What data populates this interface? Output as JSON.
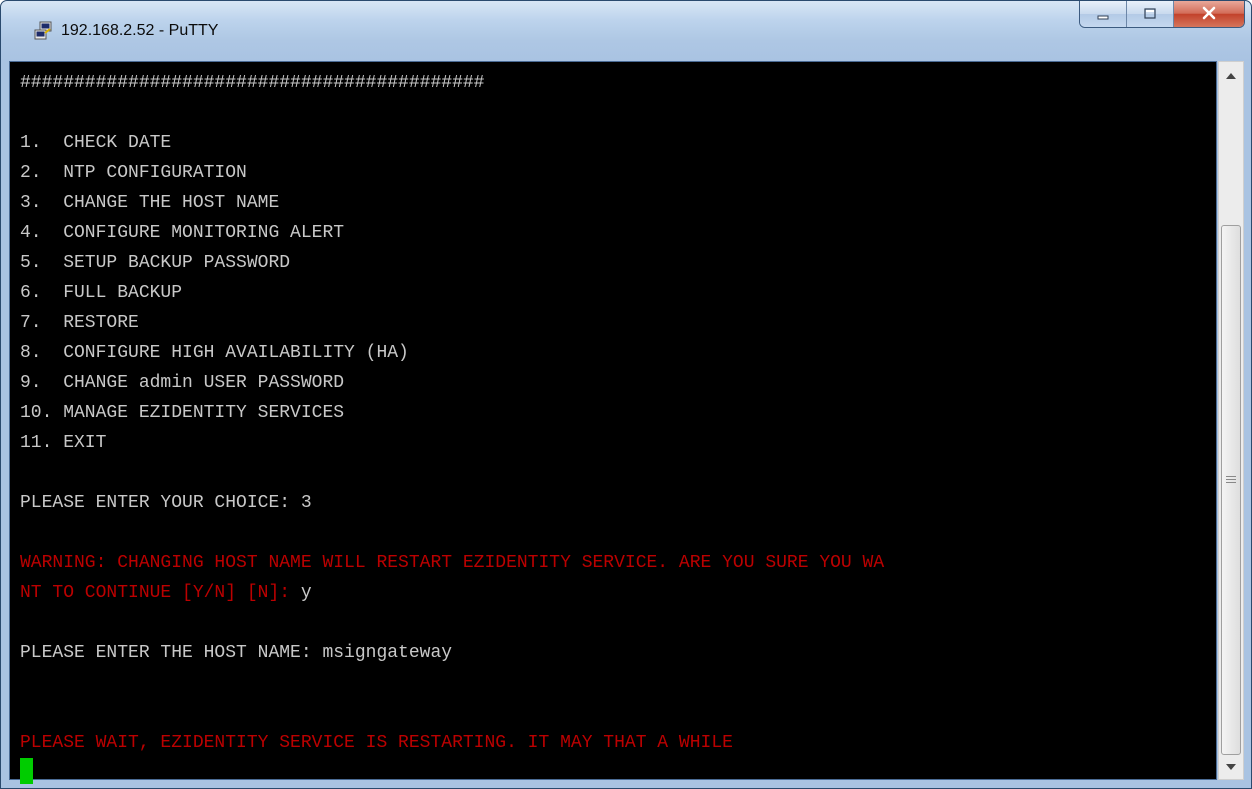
{
  "window": {
    "title": "192.168.2.52 - PuTTY",
    "icons": [
      "putty-app-icon",
      "minimize-icon",
      "maximize-icon",
      "close-icon"
    ]
  },
  "terminal": {
    "lines": [
      {
        "text": "###########################################",
        "color": "#c8c8c8"
      },
      {
        "text": "",
        "color": "#c8c8c8"
      },
      {
        "text": "1.  CHECK DATE",
        "color": "#c8c8c8"
      },
      {
        "text": "2.  NTP CONFIGURATION",
        "color": "#c8c8c8"
      },
      {
        "text": "3.  CHANGE THE HOST NAME",
        "color": "#c8c8c8"
      },
      {
        "text": "4.  CONFIGURE MONITORING ALERT",
        "color": "#c8c8c8"
      },
      {
        "text": "5.  SETUP BACKUP PASSWORD",
        "color": "#c8c8c8"
      },
      {
        "text": "6.  FULL BACKUP",
        "color": "#c8c8c8"
      },
      {
        "text": "7.  RESTORE",
        "color": "#c8c8c8"
      },
      {
        "text": "8.  CONFIGURE HIGH AVAILABILITY (HA)",
        "color": "#c8c8c8"
      },
      {
        "text": "9.  CHANGE admin USER PASSWORD",
        "color": "#c8c8c8"
      },
      {
        "text": "10. MANAGE EZIDENTITY SERVICES",
        "color": "#c8c8c8"
      },
      {
        "text": "11. EXIT",
        "color": "#c8c8c8"
      },
      {
        "text": "",
        "color": "#c8c8c8"
      },
      {
        "text": "PLEASE ENTER YOUR CHOICE: 3",
        "color": "#c8c8c8"
      },
      {
        "text": "",
        "color": "#c8c8c8"
      },
      {
        "text": "WARNING: CHANGING HOST NAME WILL RESTART EZIDENTITY SERVICE. ARE YOU SURE YOU WA",
        "color": "#bb0000"
      },
      {
        "text": "NT TO CONTINUE [Y/N] [N]: ",
        "color": "#bb0000",
        "input": "y"
      },
      {
        "text": "",
        "color": "#c8c8c8"
      },
      {
        "text": "PLEASE ENTER THE HOST NAME: msigngateway",
        "color": "#c8c8c8"
      },
      {
        "text": "",
        "color": "#c8c8c8"
      },
      {
        "text": "",
        "color": "#c8c8c8"
      },
      {
        "text": "PLEASE WAIT, EZIDENTITY SERVICE IS RESTARTING. IT MAY THAT A WHILE",
        "color": "#bb0000"
      }
    ],
    "cursor_color": "#00cc00"
  }
}
